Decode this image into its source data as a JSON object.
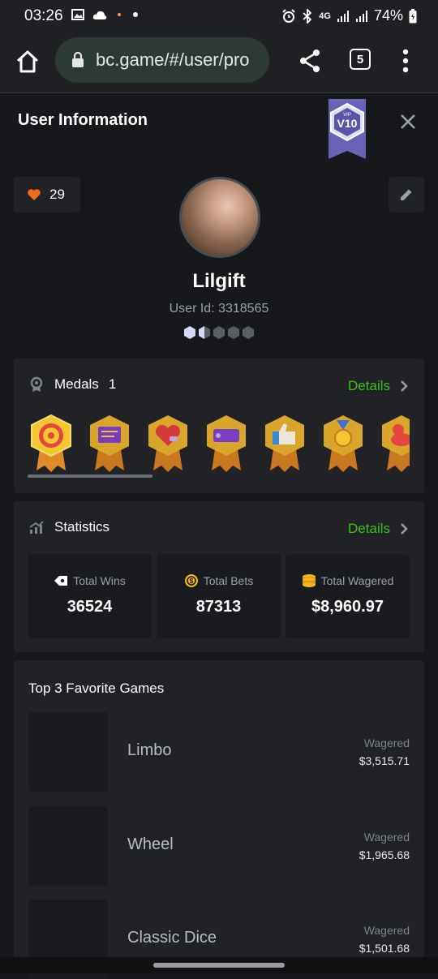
{
  "status_bar": {
    "time": "03:26",
    "battery": "74%",
    "network": "4G"
  },
  "browser": {
    "url": "bc.game/#/user/pro",
    "tab_count": "5"
  },
  "panel": {
    "title": "User Information",
    "vip_label": "V10",
    "vip_prefix": "VIP"
  },
  "profile": {
    "likes": "29",
    "username": "Lilgift",
    "user_id": "User Id: 3318565"
  },
  "medals": {
    "label": "Medals",
    "count": "1",
    "details": "Details"
  },
  "statistics": {
    "label": "Statistics",
    "details": "Details",
    "items": [
      {
        "label": "Total Wins",
        "value": "36524"
      },
      {
        "label": "Total Bets",
        "value": "87313"
      },
      {
        "label": "Total Wagered",
        "value": "$8,960.97"
      }
    ]
  },
  "favorites": {
    "title": "Top 3 Favorite Games",
    "games": [
      {
        "name": "Limbo",
        "wager_label": "Wagered",
        "wagered": "$3,515.71"
      },
      {
        "name": "Wheel",
        "wager_label": "Wagered",
        "wagered": "$1,965.68"
      },
      {
        "name": "Classic Dice",
        "wager_label": "Wagered",
        "wagered": "$1,501.68"
      }
    ]
  },
  "colors": {
    "accent_green": "#3bc117",
    "heart": "#f26a21",
    "background": "#17181b",
    "card": "#212226"
  }
}
